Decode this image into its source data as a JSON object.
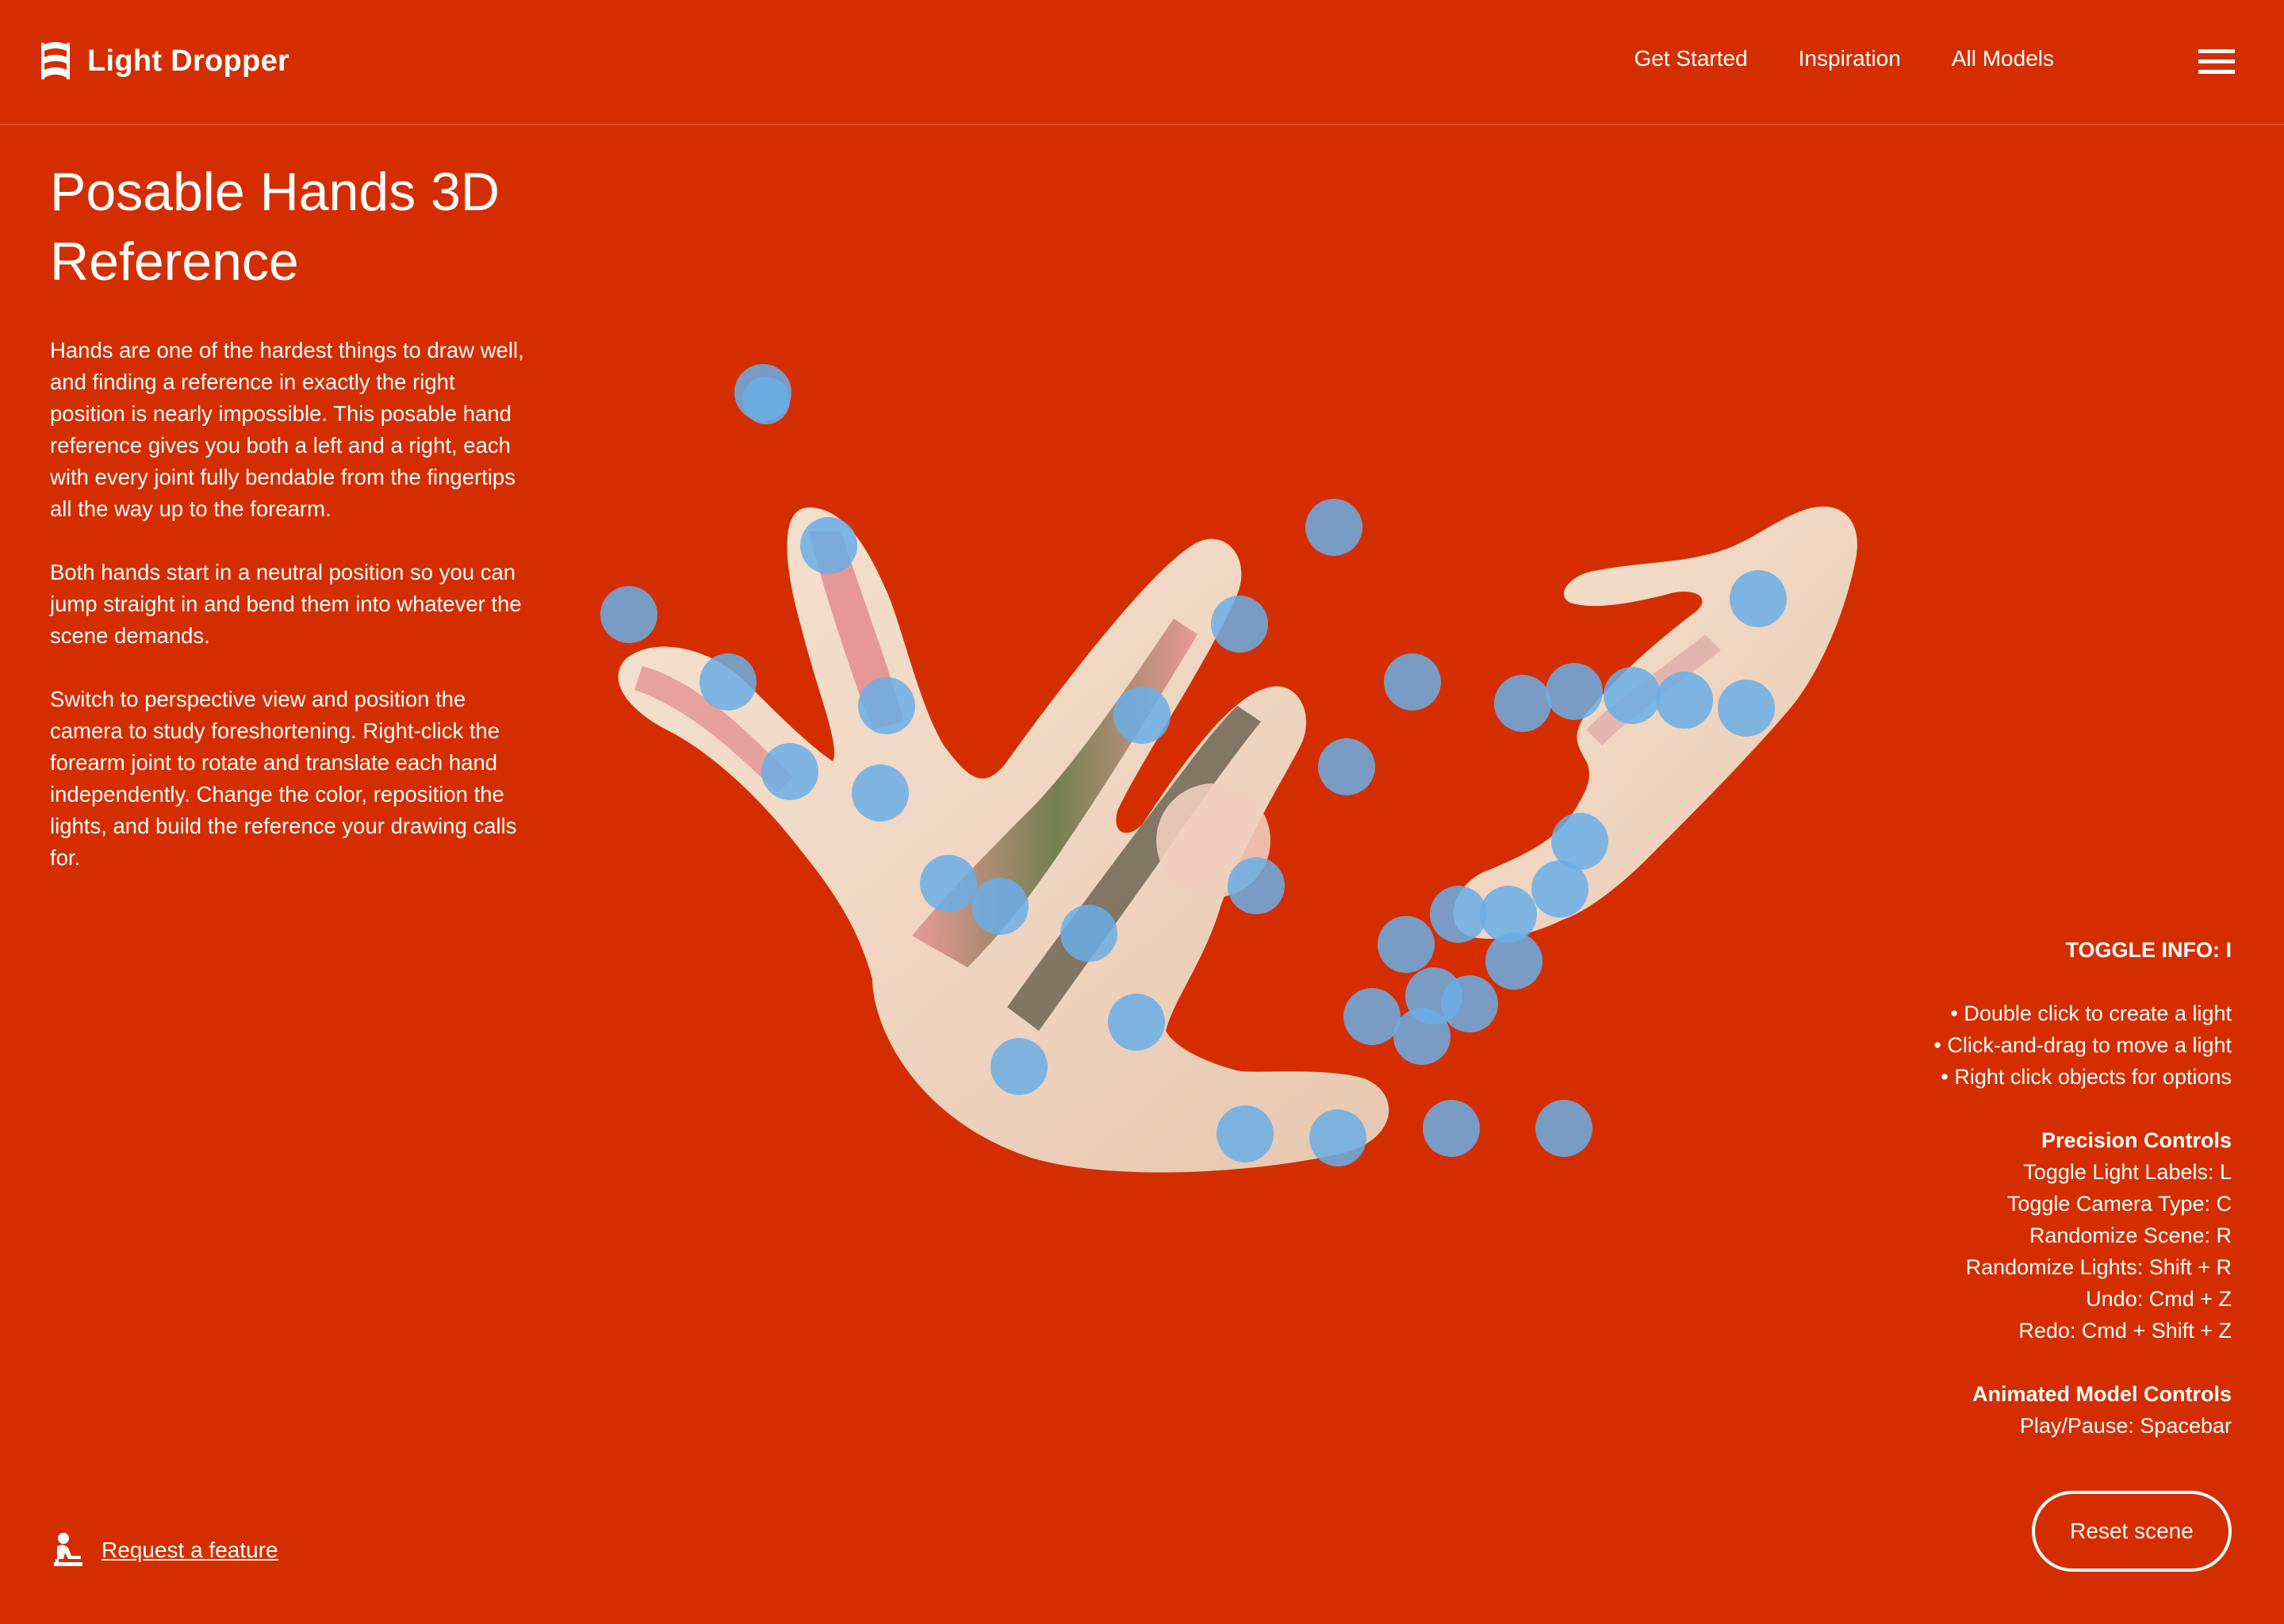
{
  "brand": {
    "name": "Light Dropper",
    "logo_icon": "light-dropper-logo-icon"
  },
  "nav": {
    "items": [
      "Get Started",
      "Inspiration",
      "All Models"
    ],
    "menu_icon": "hamburger-menu-icon"
  },
  "intro": {
    "title": "Posable Hands 3D Reference",
    "paragraphs": [
      "Hands are one of the hardest things to draw well, and finding a reference in exactly the right position is nearly impossible. This posable hand reference gives you both a left and a right, each with every joint fully bendable from the fingertips all the way up to the forearm.",
      "Both hands start in a neutral position so you can jump straight in and bend them into whatever the scene demands.",
      "Switch to perspective view and position the camera to study foreshortening. Right-click the forearm joint to rotate and translate each hand independently. Change the color, reposition the lights, and build the reference your drawing calls for."
    ]
  },
  "scene": {
    "description_icon": "posable-hands-3d-model",
    "joint_color": "#6aaee6",
    "hand_colors": [
      "#efd9c4",
      "#e89090",
      "#111111",
      "#6a7a3a"
    ]
  },
  "info": {
    "toggle": "TOGGLE INFO: I",
    "tips": [
      "Double click to create a light",
      "Click-and-drag to move a light",
      "Right click objects for options"
    ],
    "precision_title": "Precision Controls",
    "precision_items": [
      "Toggle Light Labels: L",
      "Toggle Camera Type: C",
      "Randomize Scene: R",
      "Randomize Lights: Shift + R",
      "Undo: Cmd + Z",
      "Redo: Cmd + Shift + Z"
    ],
    "animated_title": "Animated Model Controls",
    "animated_items": [
      "Play/Pause: Spacebar"
    ]
  },
  "actions": {
    "reset_label": "Reset scene",
    "request_label": "Request a feature",
    "request_icon": "person-at-desk-icon"
  },
  "colors": {
    "background": "#d42e00",
    "text": "#ffffff"
  }
}
